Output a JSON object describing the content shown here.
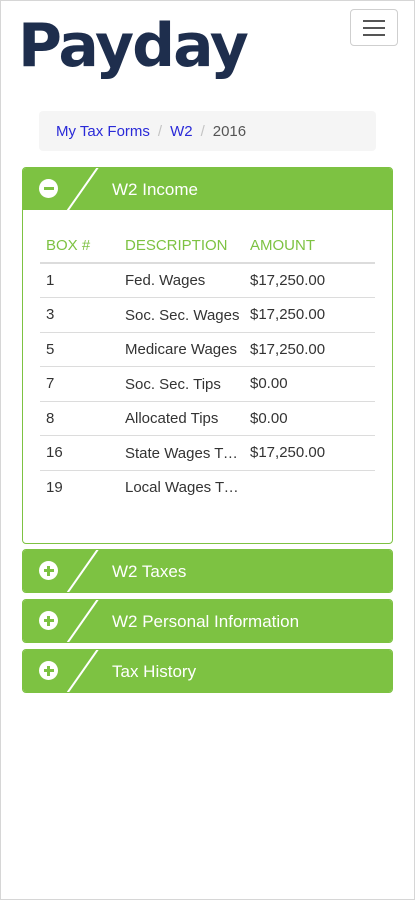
{
  "brand": {
    "logo_text": "Payday",
    "logo_color": "#1e2e4d"
  },
  "header": {
    "menu_icon": "hamburger-icon"
  },
  "breadcrumb": {
    "items": [
      {
        "label": "My Tax Forms",
        "link": true
      },
      {
        "label": "W2",
        "link": true
      },
      {
        "label": "2016",
        "link": false
      }
    ],
    "separator": "/"
  },
  "accent_color": "#7dc242",
  "panels": {
    "income": {
      "title": "W2 Income",
      "expanded": true,
      "toggle_icon": "minus-circle-icon",
      "table": {
        "headers": [
          "BOX #",
          "DESCRIPTION",
          "AMOUNT"
        ],
        "rows": [
          {
            "box": "1",
            "description": "Fed. Wages",
            "amount": "$17,250.00"
          },
          {
            "box": "3",
            "description": "Soc. Sec. Wages",
            "amount": "$17,250.00"
          },
          {
            "box": "5",
            "description": "Medicare Wages",
            "amount": "$17,250.00"
          },
          {
            "box": "7",
            "description": "Soc. Sec. Tips",
            "amount": "$0.00"
          },
          {
            "box": "8",
            "description": "Allocated Tips",
            "amount": "$0.00"
          },
          {
            "box": "16",
            "description": "State Wages Tips",
            "amount": "$17,250.00"
          },
          {
            "box": "19",
            "description": "Local Wages Tips",
            "amount": ""
          }
        ]
      }
    },
    "taxes": {
      "title": "W2 Taxes",
      "expanded": false,
      "toggle_icon": "plus-circle-icon"
    },
    "personal": {
      "title": "W2 Personal Information",
      "expanded": false,
      "toggle_icon": "plus-circle-icon"
    },
    "history": {
      "title": "Tax History",
      "expanded": false,
      "toggle_icon": "plus-circle-icon"
    }
  }
}
